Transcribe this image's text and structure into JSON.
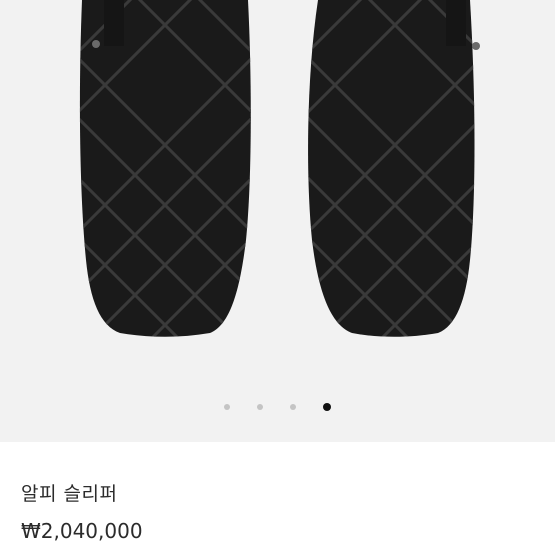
{
  "product": {
    "name": "알피 슬리퍼",
    "price": "₩2,040,000",
    "image": {
      "subject": "black-woven-leather-slippers-icon"
    }
  },
  "gallery": {
    "total_images": 4,
    "active_index": 3
  }
}
